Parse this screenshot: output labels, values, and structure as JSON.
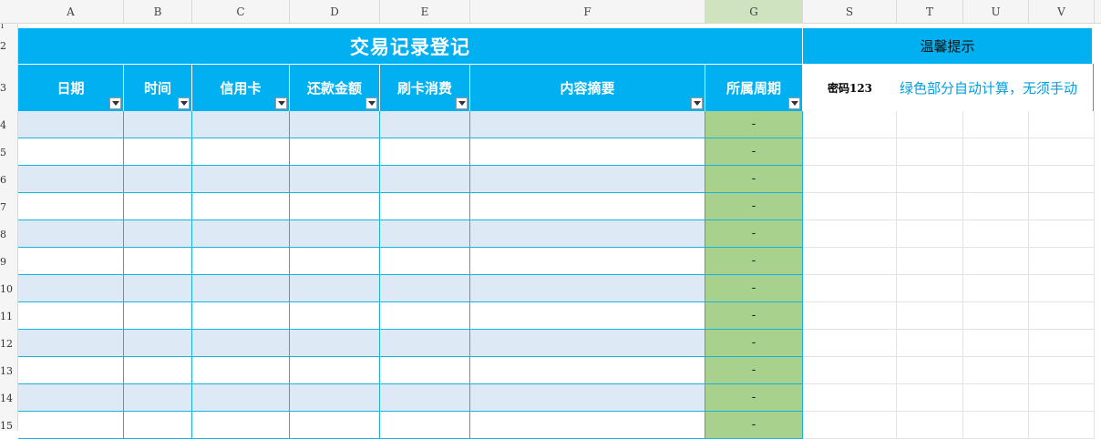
{
  "columns": {
    "a": "A",
    "b": "B",
    "c": "C",
    "d": "D",
    "e": "E",
    "f": "F",
    "g": "G",
    "s": "S",
    "t": "T",
    "u": "U",
    "v": "V"
  },
  "rows": [
    "1",
    "2",
    "3",
    "4",
    "5",
    "6",
    "7",
    "8",
    "9",
    "10",
    "11",
    "12",
    "13",
    "14",
    "15"
  ],
  "sheet": {
    "title": "交易记录登记",
    "headers": {
      "date": "日期",
      "time": "时间",
      "card": "信用卡",
      "repay": "还款金额",
      "spend": "刷卡消费",
      "summary": "内容摘要",
      "period": "所属周期"
    },
    "period_values": [
      "-",
      "-",
      "-",
      "-",
      "-",
      "-",
      "-",
      "-",
      "-",
      "-",
      "-",
      "-"
    ]
  },
  "tips": {
    "title": "温馨提示",
    "password": "密码123",
    "note": "绿色部分自动计算，无须手动"
  },
  "colors": {
    "header_blue": "#00b0f0",
    "row_stripe": "#ddeaf6",
    "calc_green": "#a9d18e"
  }
}
